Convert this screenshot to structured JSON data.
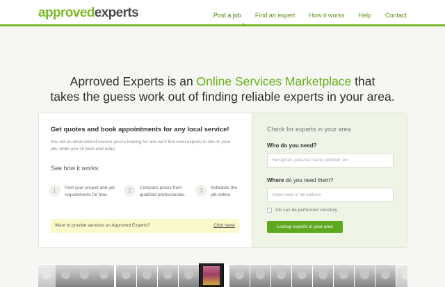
{
  "brand": {
    "logo_part1": "approved",
    "logo_part2": "experts",
    "accent": "#7cb827"
  },
  "nav": {
    "items": [
      {
        "label": "Post a job",
        "active": true
      },
      {
        "label": "Find an expert"
      },
      {
        "label": "How it works"
      },
      {
        "label": "Help"
      },
      {
        "label": "Contact"
      }
    ]
  },
  "headline": {
    "part1": "Aprroved Experts is an ",
    "highlight": "Online Services Marketplace",
    "part2": " that",
    "line2": "takes the guess work out of finding reliable experts in your area."
  },
  "left_panel": {
    "title": "Get quotes and book appointments for any local service!",
    "description": "You tell us what kind of service you're looking for and we'll find local experts to bid on your job, while you sit back and relax.",
    "how_title": "See how it works:",
    "steps": [
      {
        "num": "1",
        "text": "Post your project and job requirements for free."
      },
      {
        "num": "2",
        "text": "Compare prices from qualified professionals."
      },
      {
        "num": "3",
        "text": "Schedule the job online."
      }
    ],
    "provide_text": "Want to provide services on Approved Experts?",
    "provide_link": "Click here!"
  },
  "right_panel": {
    "title": "Check for experts in your area",
    "who_label": "Who do you need?",
    "who_placeholder": "Handyman, personal trainer, plumber, etc",
    "who_value": "",
    "where_label_bold": "Where",
    "where_label_rest": " do you need them?",
    "where_placeholder": "Postal code or full address",
    "where_value": "",
    "remote_label": "Job can be performed remotely",
    "remote_checked": false,
    "lookup_button": "Lookup experts in your area"
  },
  "strip": {
    "photo_icon": "expert-photo-icon",
    "featured_icon": "featured-expert-photo-icon"
  }
}
